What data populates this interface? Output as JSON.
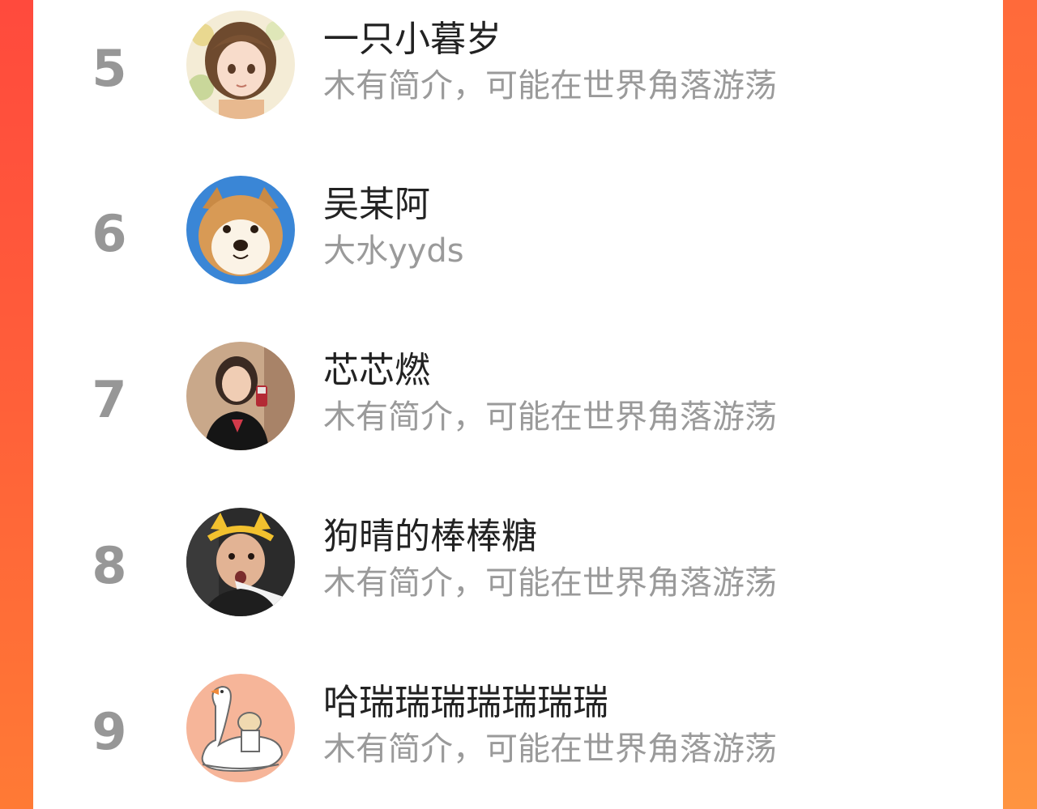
{
  "ranking_list": {
    "items": [
      {
        "rank": "5",
        "name": "一只小暮岁",
        "bio": "木有简介，可能在世界角落游荡",
        "avatar_icon": "anime-girl-avatar"
      },
      {
        "rank": "6",
        "name": "吴某阿",
        "bio": "大水yyds",
        "avatar_icon": "shiba-dog-avatar"
      },
      {
        "rank": "7",
        "name": "芯芯燃",
        "bio": "木有简介，可能在世界角落游荡",
        "avatar_icon": "selfie-girl-avatar"
      },
      {
        "rank": "8",
        "name": "狗晴的棒棒糖",
        "bio": "木有简介，可能在世界角落游荡",
        "avatar_icon": "man-headband-avatar"
      },
      {
        "rank": "9",
        "name": "哈瑞瑞瑞瑞瑞瑞瑞",
        "bio": "木有简介，可能在世界角落游荡",
        "avatar_icon": "swan-illustration-avatar"
      }
    ]
  },
  "colors": {
    "background_gradient_start": "#ff4a3d",
    "background_gradient_end": "#ff7a35",
    "rank_text": "#979797",
    "name_text": "#222222",
    "bio_text": "#9a9a9a"
  }
}
